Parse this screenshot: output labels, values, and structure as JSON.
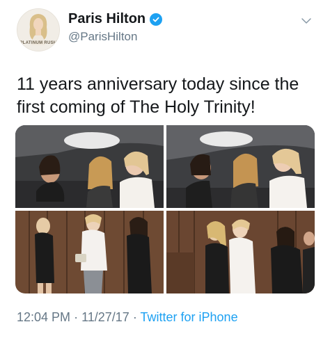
{
  "user": {
    "display_name": "Paris Hilton",
    "handle": "@ParisHilton",
    "avatar_text": "PLATINUM RUSH",
    "verified": true
  },
  "tweet": {
    "text": "11 years anniversary today since the first coming of The Holy Trinity!",
    "time": "12:04 PM",
    "date": "11/27/17",
    "separator": "·",
    "source": "Twitter for iPhone"
  },
  "media": {
    "photo_count": 4
  },
  "colors": {
    "link": "#1da1f2",
    "muted": "#657786",
    "text": "#14171a"
  },
  "icons": {
    "verified": "verified-badge-icon",
    "menu": "chevron-down-icon"
  }
}
